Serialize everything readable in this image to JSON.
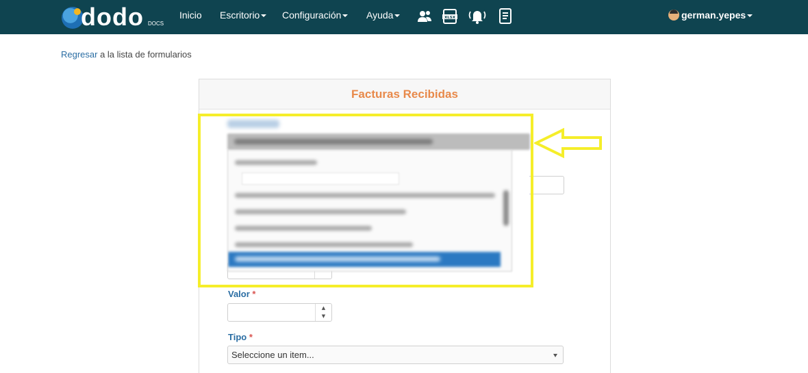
{
  "navbar": {
    "logo_text": "dodo",
    "logo_sub": "DOCS",
    "items": [
      {
        "label": "Inicio"
      },
      {
        "label": "Escritorio"
      },
      {
        "label": "Configuración"
      },
      {
        "label": "Ayuda"
      }
    ],
    "icons": [
      "users-icon",
      "xlsx-file-icon",
      "bell-alert-icon",
      "document-list-icon"
    ],
    "user_label": "german.yepes",
    "color": "#0f4450"
  },
  "back": {
    "link_label": "Regresar",
    "rest_text": " a la lista de formularios"
  },
  "form": {
    "title": "Facturas Recibidas",
    "title_color": "#e8894a",
    "fields": {
      "valor": {
        "label": "Valor",
        "required_mark": "*",
        "value": ""
      },
      "tipo": {
        "label": "Tipo",
        "required_mark": "*",
        "selected": "Seleccione un item..."
      }
    }
  },
  "annotation": {
    "highlight_color": "#f5ee2a"
  }
}
